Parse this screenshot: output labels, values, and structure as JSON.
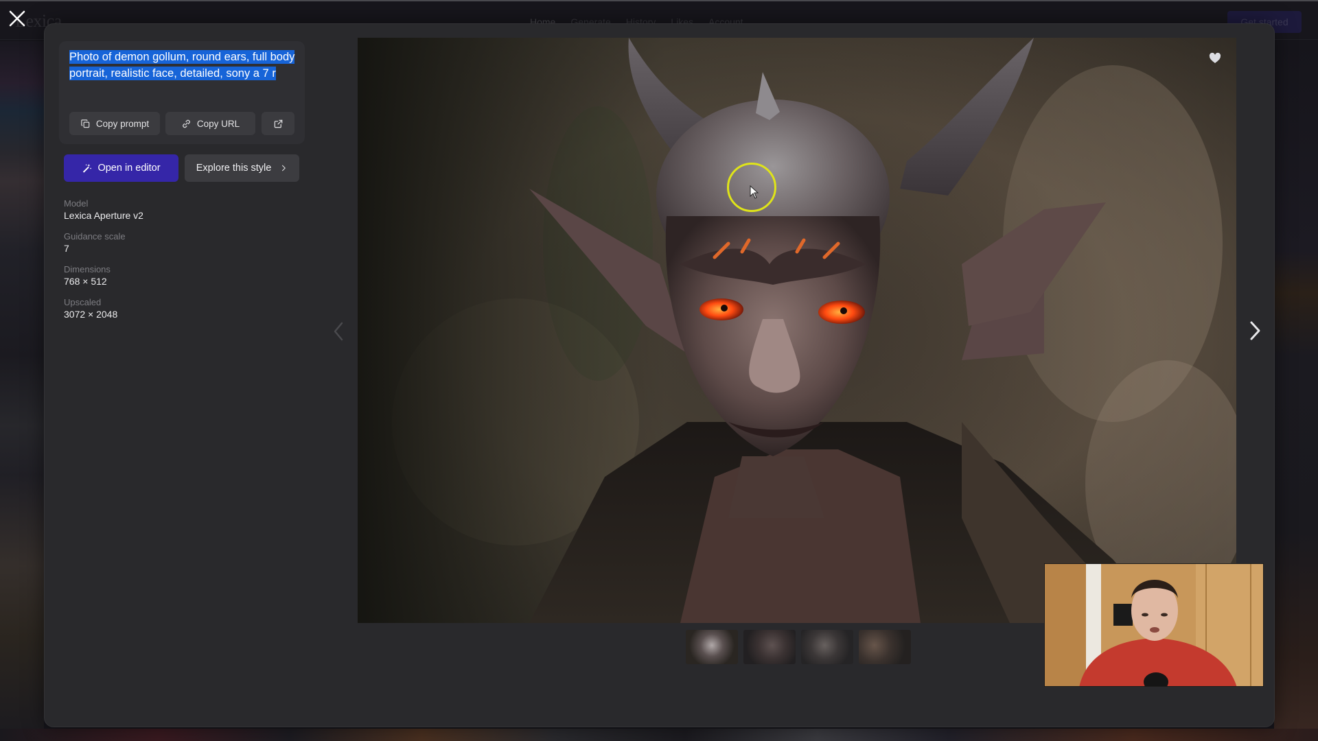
{
  "background_page": {
    "logo": "Lexica",
    "nav": [
      "Home",
      "Generate",
      "History",
      "Likes",
      "Account"
    ],
    "cta": "Get started"
  },
  "modal": {
    "prompt": "Photo of demon gollum, round ears, full body portrait, realistic face, detailed, sony a 7 r",
    "buttons": {
      "copy_prompt": "Copy prompt",
      "copy_url": "Copy URL",
      "open_external_icon": "external-link-icon",
      "open_in_editor": "Open in editor",
      "explore_style": "Explore this style"
    },
    "metadata": [
      {
        "label": "Model",
        "value": "Lexica Aperture v2"
      },
      {
        "label": "Guidance scale",
        "value": "7"
      },
      {
        "label": "Dimensions",
        "value": "768 × 512"
      },
      {
        "label": "Upscaled",
        "value": "3072 × 2048"
      }
    ],
    "image": {
      "alt": "Demon gollum portrait with horns, pointed ears and glowing orange eyes",
      "liked_icon": "heart-icon"
    },
    "thumbnails": [
      {
        "label": "Variation 1",
        "active": true
      },
      {
        "label": "Variation 2",
        "active": false
      },
      {
        "label": "Variation 3",
        "active": false
      },
      {
        "label": "Variation 4",
        "active": false
      }
    ]
  },
  "overlay": {
    "webcam": "Presenter webcam feed"
  },
  "colors": {
    "accent": "#3526a8",
    "selection": "#1764d8",
    "modal_bg": "#29292c",
    "cursor_highlight": "#dfe419"
  }
}
